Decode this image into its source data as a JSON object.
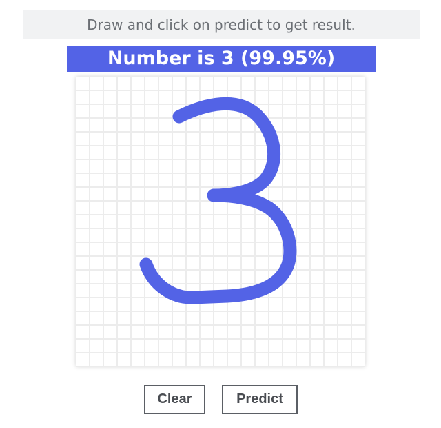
{
  "instructions": "Draw and click on predict to get result.",
  "result": {
    "label": "Number is 3 (99.95%)",
    "background_color": "#5363e6"
  },
  "canvas": {
    "stroke_color": "#5363e6",
    "grid_color": "#ececec"
  },
  "buttons": {
    "clear_label": "Clear",
    "predict_label": "Predict"
  }
}
